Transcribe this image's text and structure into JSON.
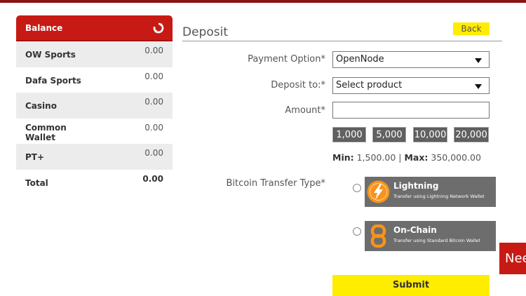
{
  "balance": {
    "title": "Balance",
    "rows": [
      {
        "name": "OW Sports",
        "value": "0.00"
      },
      {
        "name": "Dafa Sports",
        "value": "0.00"
      },
      {
        "name": "Casino",
        "value": "0.00"
      },
      {
        "name": "Common Wallet",
        "value": "0.00"
      },
      {
        "name": "PT+",
        "value": "0.00"
      },
      {
        "name": "Total",
        "value": "0.00"
      }
    ]
  },
  "deposit": {
    "title": "Deposit",
    "back_label": "Back",
    "payment_option_label": "Payment Option*",
    "payment_option_value": "OpenNode",
    "deposit_to_label": "Deposit to:*",
    "deposit_to_value": "Select product",
    "amount_label": "Amount*",
    "amount_value": "",
    "quick_amounts": [
      "1,000",
      "5,000",
      "10,000",
      "20,000"
    ],
    "min_label": "Min:",
    "min_value": "1,500.00",
    "separator": "|",
    "max_label": "Max:",
    "max_value": "350,000.00",
    "transfer_type_label": "Bitcoin Transfer Type*",
    "options": [
      {
        "name": "Lightning",
        "desc": "Transfer using Lightning Network Wallet"
      },
      {
        "name": "On-Chain",
        "desc": "Transfer using Standard Bitcoin Wallet"
      }
    ],
    "submit_label": "Submit"
  },
  "help_tab": {
    "label": "Need"
  },
  "colors": {
    "brand_red": "#c81a14",
    "accent_yellow": "#ffed00",
    "option_bg": "#6d6d6d",
    "bitcoin_orange": "#f7931a"
  }
}
